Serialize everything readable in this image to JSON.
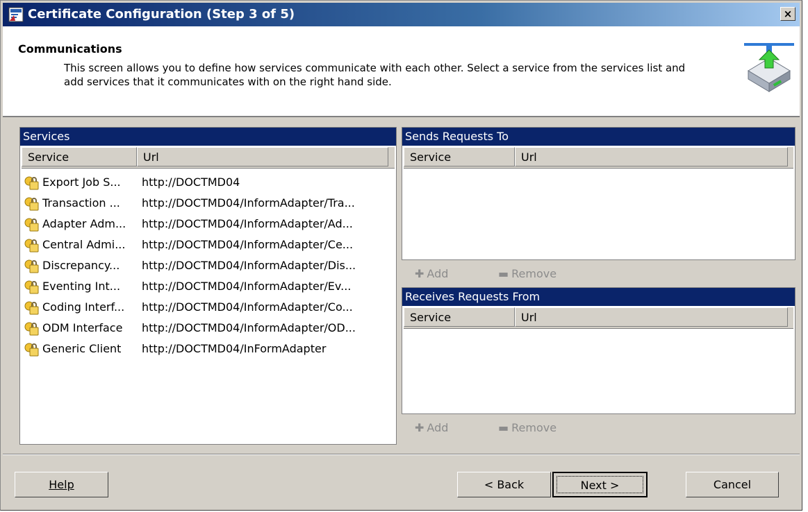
{
  "window": {
    "title": "Certificate Configuration (Step 3 of 5)",
    "close_label": "×"
  },
  "header": {
    "title": "Communications",
    "description": "This screen allows you to define how services communicate with each other.  Select a service from the services list and add services that it communicates with on the right hand side."
  },
  "services": {
    "title": "Services",
    "columns": [
      "Service",
      "Url"
    ],
    "rows": [
      {
        "service": "Export Job S...",
        "url": "http://DOCTMD04"
      },
      {
        "service": "Transaction ...",
        "url": "http://DOCTMD04/InformAdapter/Tra..."
      },
      {
        "service": "Adapter Adm...",
        "url": "http://DOCTMD04/InformAdapter/Ad..."
      },
      {
        "service": "Central Admi...",
        "url": "http://DOCTMD04/InformAdapter/Ce..."
      },
      {
        "service": "Discrepancy...",
        "url": "http://DOCTMD04/InformAdapter/Dis..."
      },
      {
        "service": "Eventing Int...",
        "url": "http://DOCTMD04/InformAdapter/Ev..."
      },
      {
        "service": "Coding Interf...",
        "url": "http://DOCTMD04/InformAdapter/Co..."
      },
      {
        "service": "ODM Interface",
        "url": "http://DOCTMD04/InformAdapter/OD..."
      },
      {
        "service": "Generic Client",
        "url": "http://DOCTMD04/InFormAdapter"
      }
    ]
  },
  "sends": {
    "title": "Sends Requests To",
    "columns": [
      "Service",
      "Url"
    ],
    "add_label": "Add",
    "remove_label": "Remove"
  },
  "receives": {
    "title": "Receives Requests From",
    "columns": [
      "Service",
      "Url"
    ],
    "add_label": "Add",
    "remove_label": "Remove"
  },
  "buttons": {
    "help": "Help",
    "back": "< Back",
    "next": "Next >",
    "cancel": "Cancel"
  },
  "colors": {
    "panel_header": "#0a246a",
    "dialog_face": "#d4d0c8",
    "disabled_text": "#8c8c8c"
  }
}
